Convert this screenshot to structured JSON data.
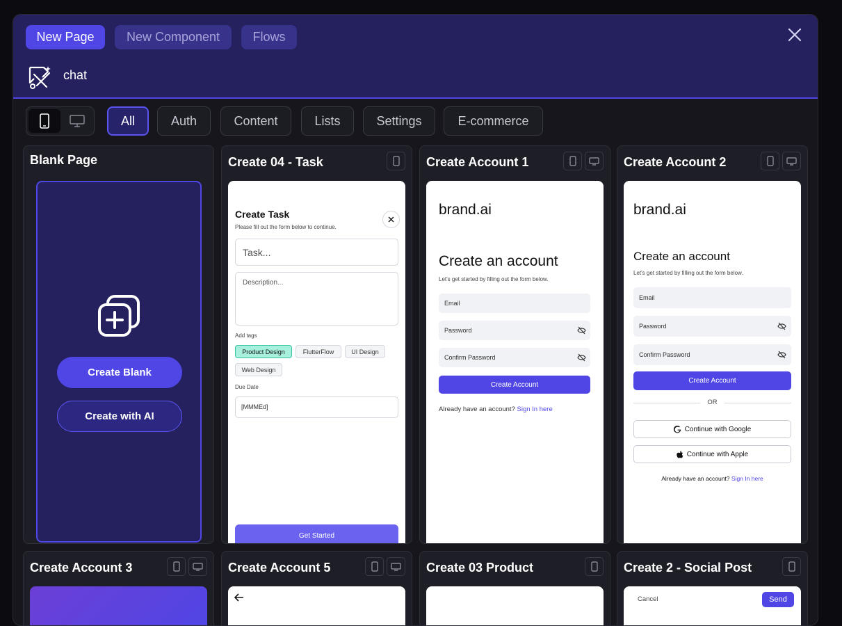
{
  "tabs": [
    {
      "label": "New Page",
      "active": true
    },
    {
      "label": "New Component",
      "active": false
    },
    {
      "label": "Flows",
      "active": false
    }
  ],
  "project": {
    "name": "chat"
  },
  "filters": [
    "All",
    "Auth",
    "Content",
    "Lists",
    "Settings",
    "E-commerce"
  ],
  "cards": {
    "blank": {
      "title": "Blank Page",
      "create_blank": "Create Blank",
      "create_ai": "Create with AI"
    },
    "task": {
      "title": "Create 04 - Task",
      "heading": "Create Task",
      "subtitle": "Please fill out the form below to continue.",
      "task_placeholder": "Task...",
      "desc_placeholder": "Description...",
      "tags_label": "Add tags",
      "tags": [
        "Product Design",
        "FlutterFlow",
        "UI Design",
        "Web Design"
      ],
      "due_label": "Due Date",
      "due_value": "[MMMEd]",
      "button": "Get Started"
    },
    "account1": {
      "title": "Create Account 1",
      "brand": "brand.ai",
      "heading": "Create an account",
      "subtitle": "Let's get started by filling out the form below.",
      "email": "Email",
      "password": "Password",
      "confirm": "Confirm Password",
      "button": "Create Account",
      "signin_prefix": "Already have an account?",
      "signin_link": "Sign In here"
    },
    "account2": {
      "title": "Create Account 2",
      "brand": "brand.ai",
      "heading": "Create an account",
      "subtitle": "Let's get started by filling out the form below.",
      "email": "Email",
      "password": "Password",
      "confirm": "Confirm Password",
      "button": "Create Account",
      "or": "OR",
      "google": "Continue with Google",
      "apple": "Continue with Apple",
      "signin_prefix": "Already have an account?",
      "signin_link": "Sign In here"
    },
    "account3": {
      "title": "Create Account 3"
    },
    "account5": {
      "title": "Create Account 5"
    },
    "product": {
      "title": "Create 03 Product"
    },
    "social": {
      "title": "Create 2 - Social Post",
      "cancel": "Cancel",
      "send": "Send"
    }
  },
  "colors": {
    "accent": "#4f46e5",
    "header_bg": "#25215e",
    "panel_bg": "#16161c",
    "link": "#4f46e5"
  }
}
